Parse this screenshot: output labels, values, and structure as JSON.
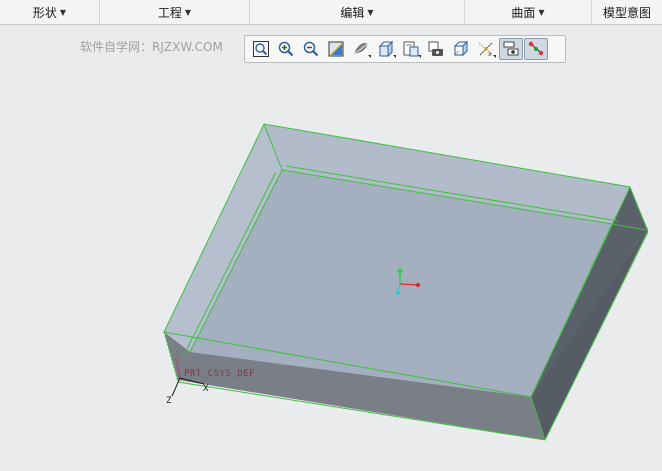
{
  "menubar": {
    "items": [
      {
        "label": "形状"
      },
      {
        "label": "工程"
      },
      {
        "label": "编辑"
      },
      {
        "label": "曲面"
      },
      {
        "label": "模型意图"
      }
    ]
  },
  "watermark": "软件自学网：RJZXW.COM",
  "toolbar": {
    "buttons": [
      {
        "icon": "zoom-fit-icon"
      },
      {
        "icon": "zoom-in-icon"
      },
      {
        "icon": "zoom-out-icon"
      },
      {
        "icon": "repaint-icon"
      },
      {
        "icon": "display-style-icon"
      },
      {
        "icon": "saved-orientations-icon"
      },
      {
        "icon": "view-manager-icon"
      },
      {
        "icon": "perspective-icon"
      },
      {
        "icon": "named-views-icon"
      },
      {
        "icon": "datum-display-icon"
      },
      {
        "icon": "annotation-display-icon",
        "active": true
      },
      {
        "icon": "spin-center-icon",
        "active": true
      }
    ]
  },
  "viewport": {
    "csys_label": "PRT_CSYS_DEF",
    "axis_z": "Z",
    "axis_x": "X",
    "colors": {
      "face_top": "#a7b2c3",
      "face_inner": "#a4afc0",
      "face_front": "#7a7e86",
      "face_side": "#5b616b",
      "edge": "#3fbf3f"
    }
  }
}
